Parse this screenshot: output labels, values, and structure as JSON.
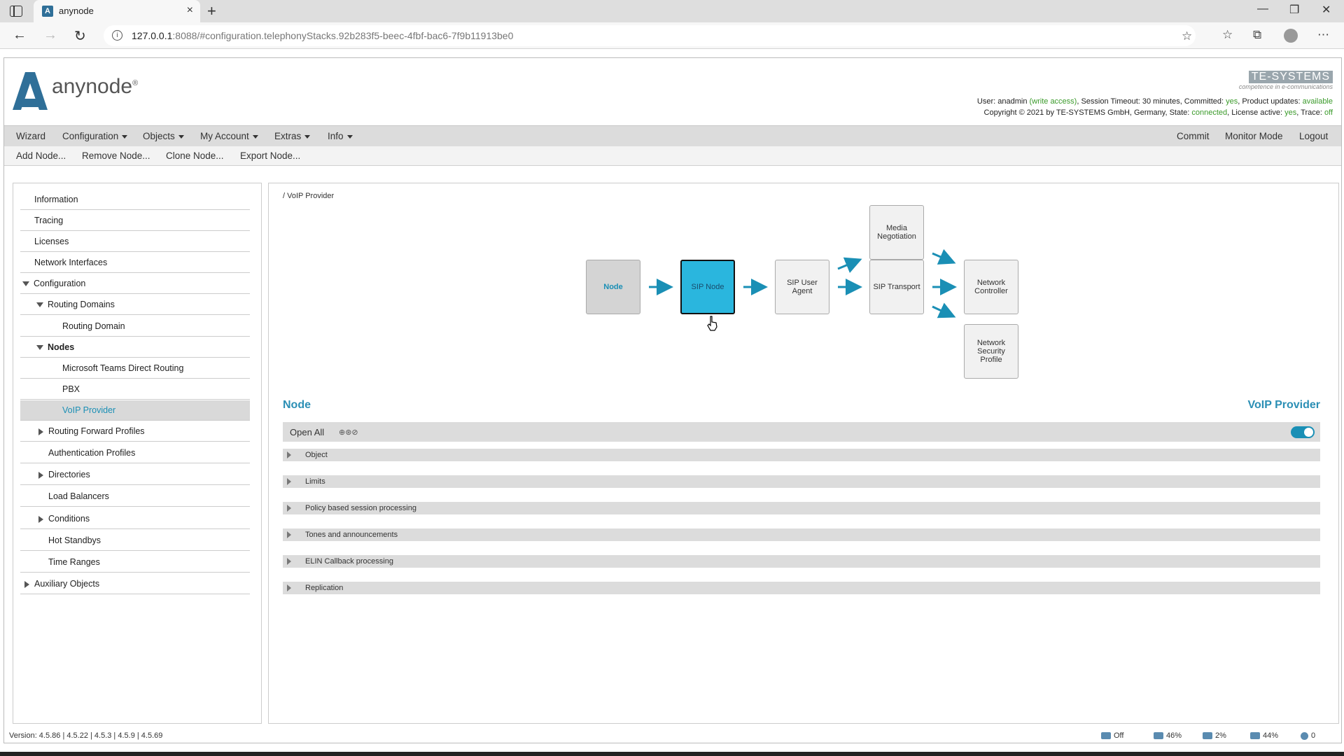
{
  "browser": {
    "tab_title": "anynode",
    "tab_close": "×",
    "new_tab": "+",
    "url_host": "127.0.0.1",
    "url_rest": ":8088/#configuration.telephonyStacks.92b283f5-beec-4fbf-bac6-7f9b11913be0",
    "info_icon": "i"
  },
  "header": {
    "logo_text": "anynode",
    "logo_reg": "®",
    "brand_name": "TE-SYSTEMS",
    "brand_tagline": "competence in e-communications",
    "status_line1": {
      "user_label": "User: anadmin ",
      "write_access": "(write access)",
      "session": ", Session Timeout: 30 minutes, Committed: ",
      "committed": "yes",
      "updates_label": ", Product updates: ",
      "updates": "available"
    },
    "status_line2": {
      "copyright": "Copyright © 2021 by TE-SYSTEMS GmbH, Germany, State: ",
      "state": "connected",
      "license_label": ", License active: ",
      "license": "yes",
      "trace_label": ", Trace: ",
      "trace": "off"
    }
  },
  "menu": {
    "wizard": "Wizard",
    "configuration": "Configuration",
    "objects": "Objects",
    "my_account": "My Account",
    "extras": "Extras",
    "info": "Info",
    "commit": "Commit",
    "monitor_mode": "Monitor Mode",
    "logout": "Logout"
  },
  "submenu": {
    "add_node": "Add Node...",
    "remove_node": "Remove Node...",
    "clone_node": "Clone Node...",
    "export_node": "Export Node..."
  },
  "sidebar": {
    "items": [
      {
        "label": "Information"
      },
      {
        "label": "Tracing"
      },
      {
        "label": "Licenses"
      },
      {
        "label": "Network Interfaces"
      },
      {
        "label": "Configuration"
      },
      {
        "label": "Routing Domains"
      },
      {
        "label": "Routing Domain"
      },
      {
        "label": "Nodes"
      },
      {
        "label": "Microsoft Teams Direct Routing"
      },
      {
        "label": "PBX"
      },
      {
        "label": "VoIP Provider"
      },
      {
        "label": "Routing Forward Profiles"
      },
      {
        "label": "Authentication Profiles"
      },
      {
        "label": "Directories"
      },
      {
        "label": "Load Balancers"
      },
      {
        "label": "Conditions"
      },
      {
        "label": "Hot Standbys"
      },
      {
        "label": "Time Ranges"
      },
      {
        "label": "Auxiliary Objects"
      }
    ]
  },
  "main": {
    "breadcrumb": "/ VoIP Provider",
    "diagram": {
      "node": "Node",
      "sip_node": "SIP Node",
      "sip_user_agent": "SIP User Agent",
      "media_negotiation": "Media Negotiation",
      "sip_transport": "SIP Transport",
      "network_controller": "Network Controller",
      "network_security_profile": "Network Security Profile"
    },
    "section_left": "Node",
    "section_right": "VoIP Provider",
    "open_all": "Open All",
    "open_all_icons": "⊕⊛⊘",
    "sections": [
      {
        "label": "Object"
      },
      {
        "label": "Limits"
      },
      {
        "label": "Policy based session processing"
      },
      {
        "label": "Tones and announcements"
      },
      {
        "label": "ELIN Callback processing"
      },
      {
        "label": "Replication"
      }
    ]
  },
  "footer": {
    "version": "Version: 4.5.86 | 4.5.22 | 4.5.3 | 4.5.9 | 4.5.69",
    "stat_off": "Off",
    "stat_disk": "46%",
    "stat_cpu": "2%",
    "stat_mem": "44%",
    "stat_info": "0"
  },
  "colors": {
    "accent": "#1a8fb5",
    "active_node": "#2ab6de",
    "green": "#3a9a2a"
  }
}
